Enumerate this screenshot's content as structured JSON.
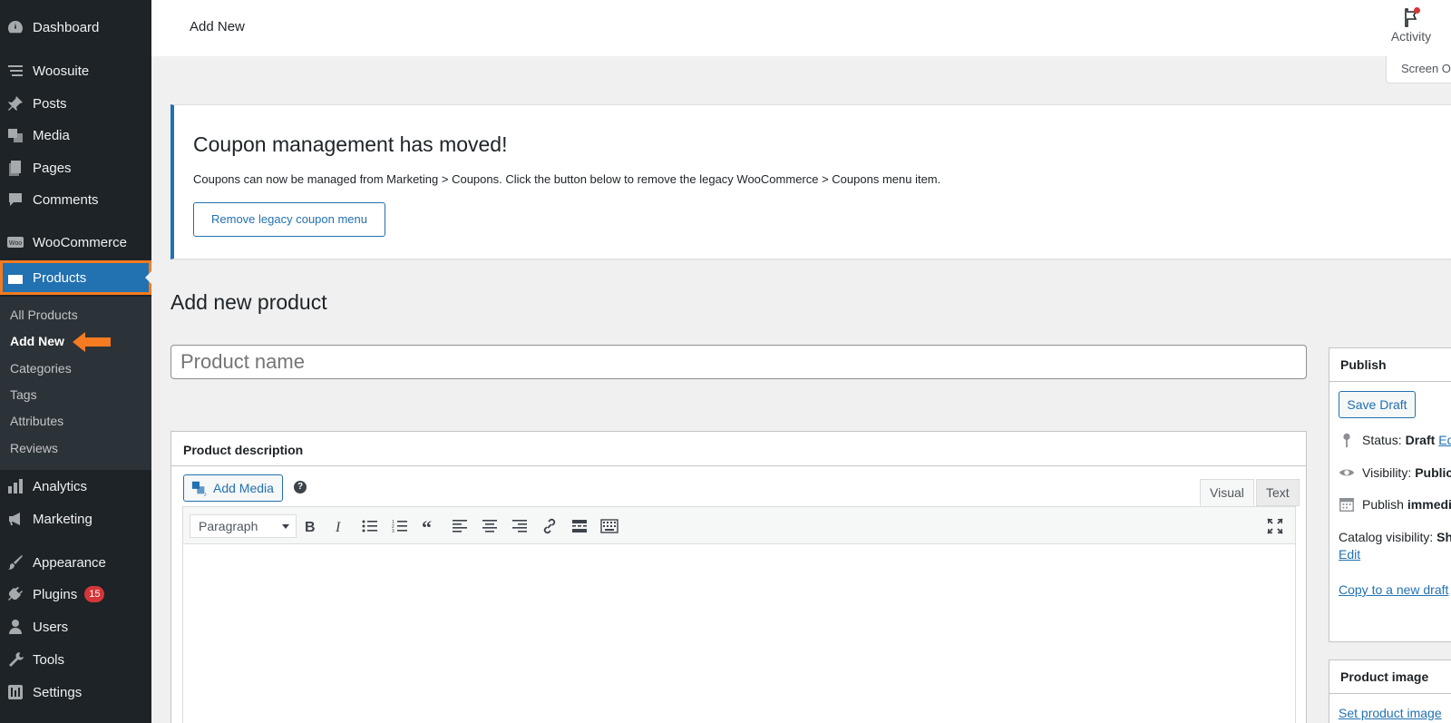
{
  "sidebar": {
    "items": [
      {
        "label": "Dashboard",
        "icon": "dashboard-icon"
      },
      {
        "label": "Woosuite",
        "icon": "woosuite-icon"
      },
      {
        "label": "Posts",
        "icon": "pin-icon"
      },
      {
        "label": "Media",
        "icon": "media-icon"
      },
      {
        "label": "Pages",
        "icon": "pages-icon"
      },
      {
        "label": "Comments",
        "icon": "comments-icon"
      },
      {
        "label": "WooCommerce",
        "icon": "woocommerce-icon"
      },
      {
        "label": "Products",
        "icon": "products-icon"
      },
      {
        "label": "Analytics",
        "icon": "analytics-icon"
      },
      {
        "label": "Marketing",
        "icon": "megaphone-icon"
      },
      {
        "label": "Appearance",
        "icon": "paintbrush-icon"
      },
      {
        "label": "Plugins",
        "icon": "plugins-icon",
        "badge": "15"
      },
      {
        "label": "Users",
        "icon": "users-icon"
      },
      {
        "label": "Tools",
        "icon": "wrench-icon"
      },
      {
        "label": "Settings",
        "icon": "settings-icon"
      }
    ],
    "submenu": [
      "All Products",
      "Add New",
      "Categories",
      "Tags",
      "Attributes",
      "Reviews"
    ],
    "highlight_color": "#f47b20",
    "active_color": "#2271b1"
  },
  "header": {
    "title": "Add New",
    "activity_label": "Activity",
    "screen_options": "Screen O"
  },
  "notice": {
    "title": "Coupon management has moved!",
    "text": "Coupons can now be managed from Marketing > Coupons. Click the button below to remove the legacy WooCommerce > Coupons menu item.",
    "button": "Remove legacy coupon menu"
  },
  "page": {
    "heading": "Add new product",
    "title_placeholder": "Product name"
  },
  "description": {
    "header": "Product description",
    "add_media": "Add Media",
    "tab_visual": "Visual",
    "tab_text": "Text",
    "format": "Paragraph"
  },
  "publish": {
    "header": "Publish",
    "save_draft": "Save Draft",
    "status_label": "Status:",
    "status_value": "Draft",
    "status_edit": "Edit",
    "visibility_label": "Visibility:",
    "visibility_value": "Public",
    "publish_label": "Publish",
    "publish_value": "immedia",
    "catalog_label": "Catalog visibility:",
    "catalog_value": "Sho",
    "catalog_edit": "Edit",
    "copy_draft": "Copy to a new draft"
  },
  "product_image": {
    "header": "Product image",
    "set_link": "Set product image"
  }
}
